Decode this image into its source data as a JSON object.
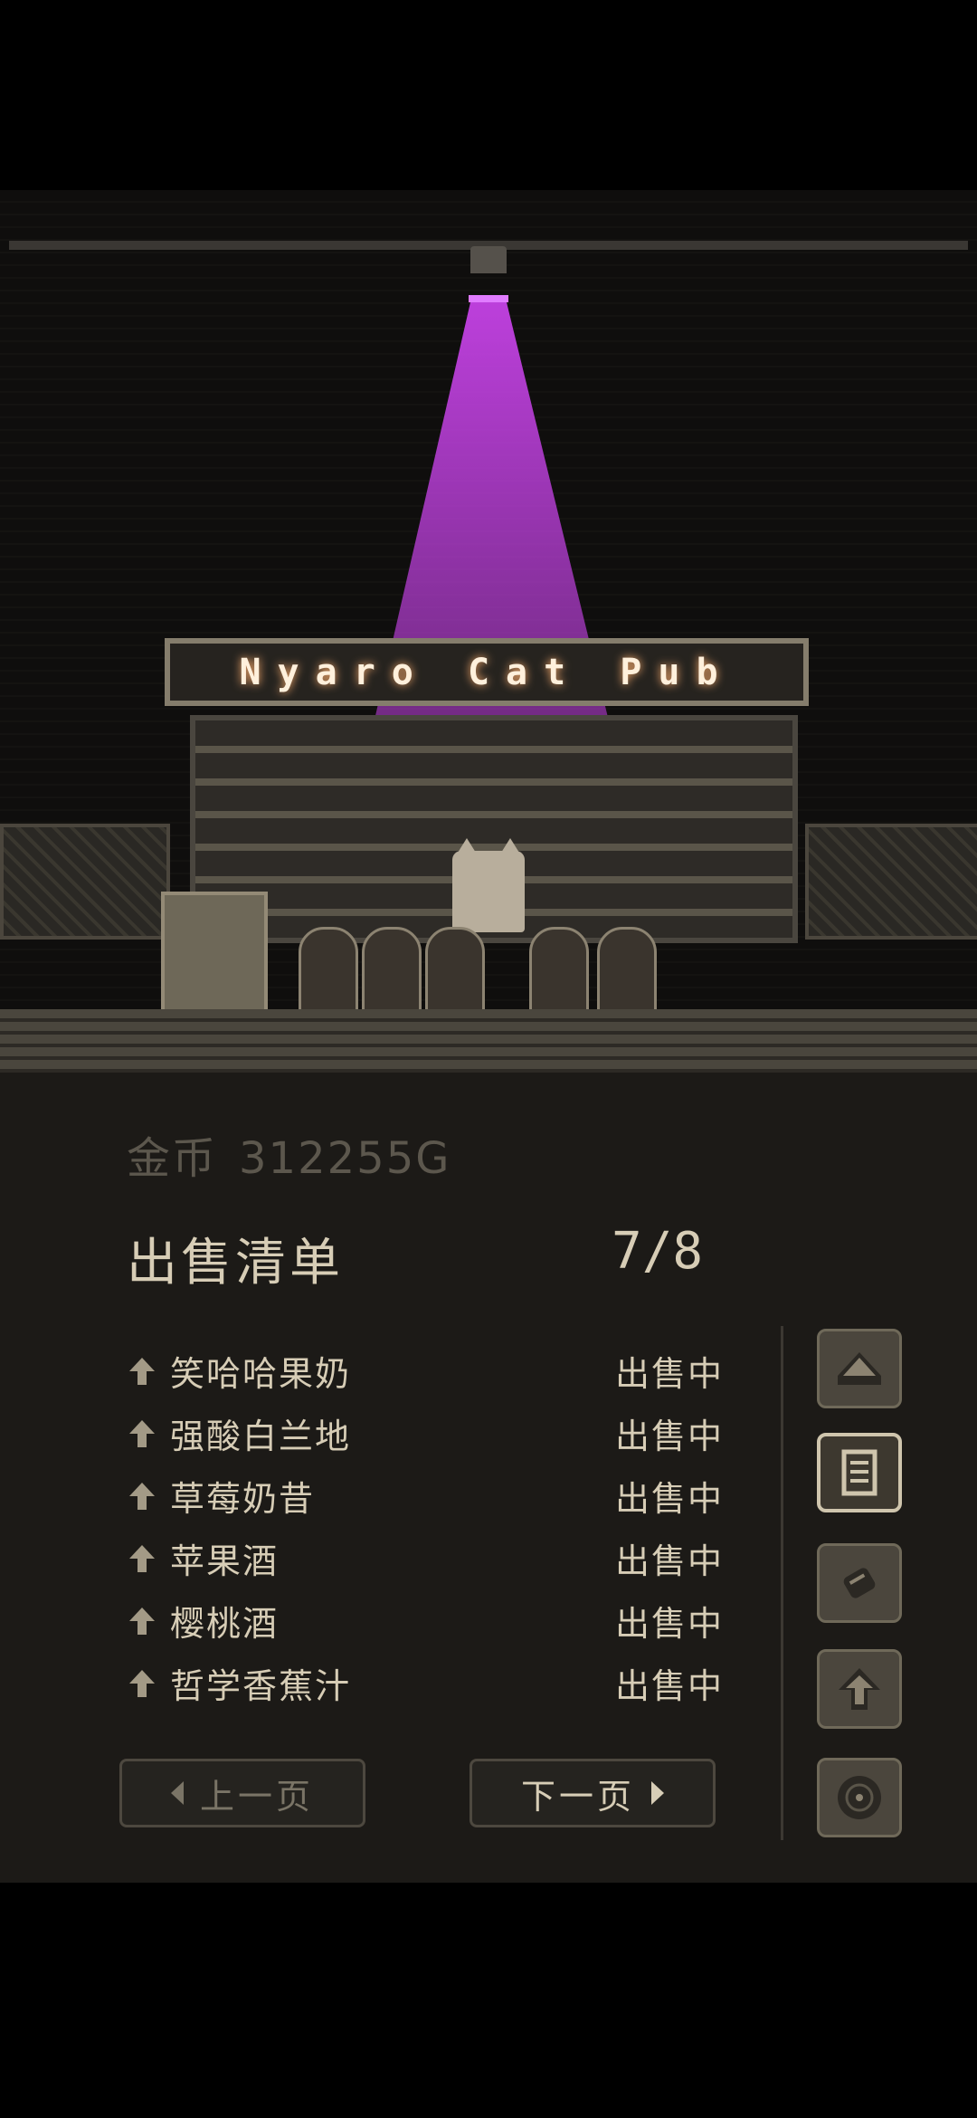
{
  "scene": {
    "sign_text": "Nyaro Cat Pub",
    "beam_color": "#c542e6"
  },
  "panel": {
    "gold_label": "金币",
    "gold_value": "312255G",
    "list_title": "出售清单",
    "page_indicator": "7/8",
    "items": [
      {
        "name": "笑哈哈果奶",
        "status": "出售中"
      },
      {
        "name": "强酸白兰地",
        "status": "出售中"
      },
      {
        "name": "草莓奶昔",
        "status": "出售中"
      },
      {
        "name": "苹果酒",
        "status": "出售中"
      },
      {
        "name": "樱桃酒",
        "status": "出售中"
      },
      {
        "name": "哲学香蕉汁",
        "status": "出售中"
      }
    ],
    "prev_label": "上一页",
    "next_label": "下一页"
  },
  "side_buttons": [
    {
      "icon": "home-icon"
    },
    {
      "icon": "list-icon",
      "active": true
    },
    {
      "icon": "scroll-icon"
    },
    {
      "icon": "upgrade-arrow-icon"
    },
    {
      "icon": "record-disc-icon"
    }
  ],
  "colors": {
    "text_primary": "#d7cdb6",
    "text_dim": "#5c574d",
    "panel_bg": "#1c1a17"
  }
}
